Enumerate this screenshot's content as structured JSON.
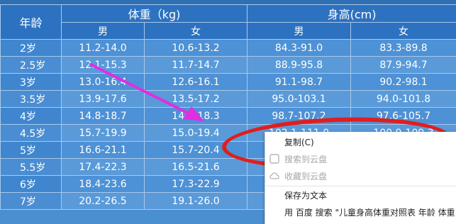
{
  "table": {
    "age_header": "年龄",
    "weight_header": "体重（kg)",
    "height_header": "身高(cm)",
    "male": "男",
    "female": "女",
    "rows": [
      {
        "age": "2岁",
        "wm": "11.2-14.0",
        "wf": "10.6-13.2",
        "hm": "84.3-91.0",
        "hf": "83.3-89.8"
      },
      {
        "age": "2.5岁",
        "wm": "12.1-15.3",
        "wf": "11.7-14.7",
        "hm": "88.9-95.8",
        "hf": "87.9-94.7"
      },
      {
        "age": "3岁",
        "wm": "13.0-16.4",
        "wf": "12.6-16.1",
        "hm": "91.1-98.7",
        "hf": "90.2-98.1"
      },
      {
        "age": "3.5岁",
        "wm": "13.9-17.6",
        "wf": "13.5-17.2",
        "hm": "95.0-103.1",
        "hf": "94.0-101.8"
      },
      {
        "age": "4岁",
        "wm": "14.8-18.7",
        "wf": "14.3-18.3",
        "hm": "98.7-107.2",
        "hf": "97.6-105.7"
      },
      {
        "age": "4.5岁",
        "wm": "15.7-19.9",
        "wf": "15.0-19.4",
        "hm": "102.1-111.0",
        "hf": "100.9-109.3"
      },
      {
        "age": "5岁",
        "wm": "16.6-21.1",
        "wf": "15.7-20.4",
        "hm": "",
        "hf": ""
      },
      {
        "age": "5.5岁",
        "wm": "17.4-22.3",
        "wf": "16.5-21.6",
        "hm": "",
        "hf": ""
      },
      {
        "age": "6岁",
        "wm": "18.4-23.6",
        "wf": "17.3-22.9",
        "hm": "",
        "hf": ""
      },
      {
        "age": "7岁",
        "wm": "20.2-26.5",
        "wf": "19.1-26.0",
        "hm": "",
        "hf": ""
      }
    ]
  },
  "context_menu": {
    "items": [
      {
        "label": "复制(C)",
        "enabled": true,
        "icon": ""
      },
      {
        "label": "搜索到云盘",
        "enabled": false,
        "icon": "baidu-icon"
      },
      {
        "label": "收藏到云盘",
        "enabled": false,
        "icon": "cloud-icon"
      },
      {
        "label": "保存为文本",
        "enabled": true,
        "icon": ""
      },
      {
        "label": "用 百度 搜索 \"儿童身高体重对照表 年龄 体重",
        "enabled": true,
        "icon": ""
      }
    ]
  },
  "colors": {
    "header_bg": "#2d72c0",
    "cell_bg": "#4d91d6",
    "annotation_red": "#e01e1e",
    "arrow_magenta": "#e02ee0"
  }
}
